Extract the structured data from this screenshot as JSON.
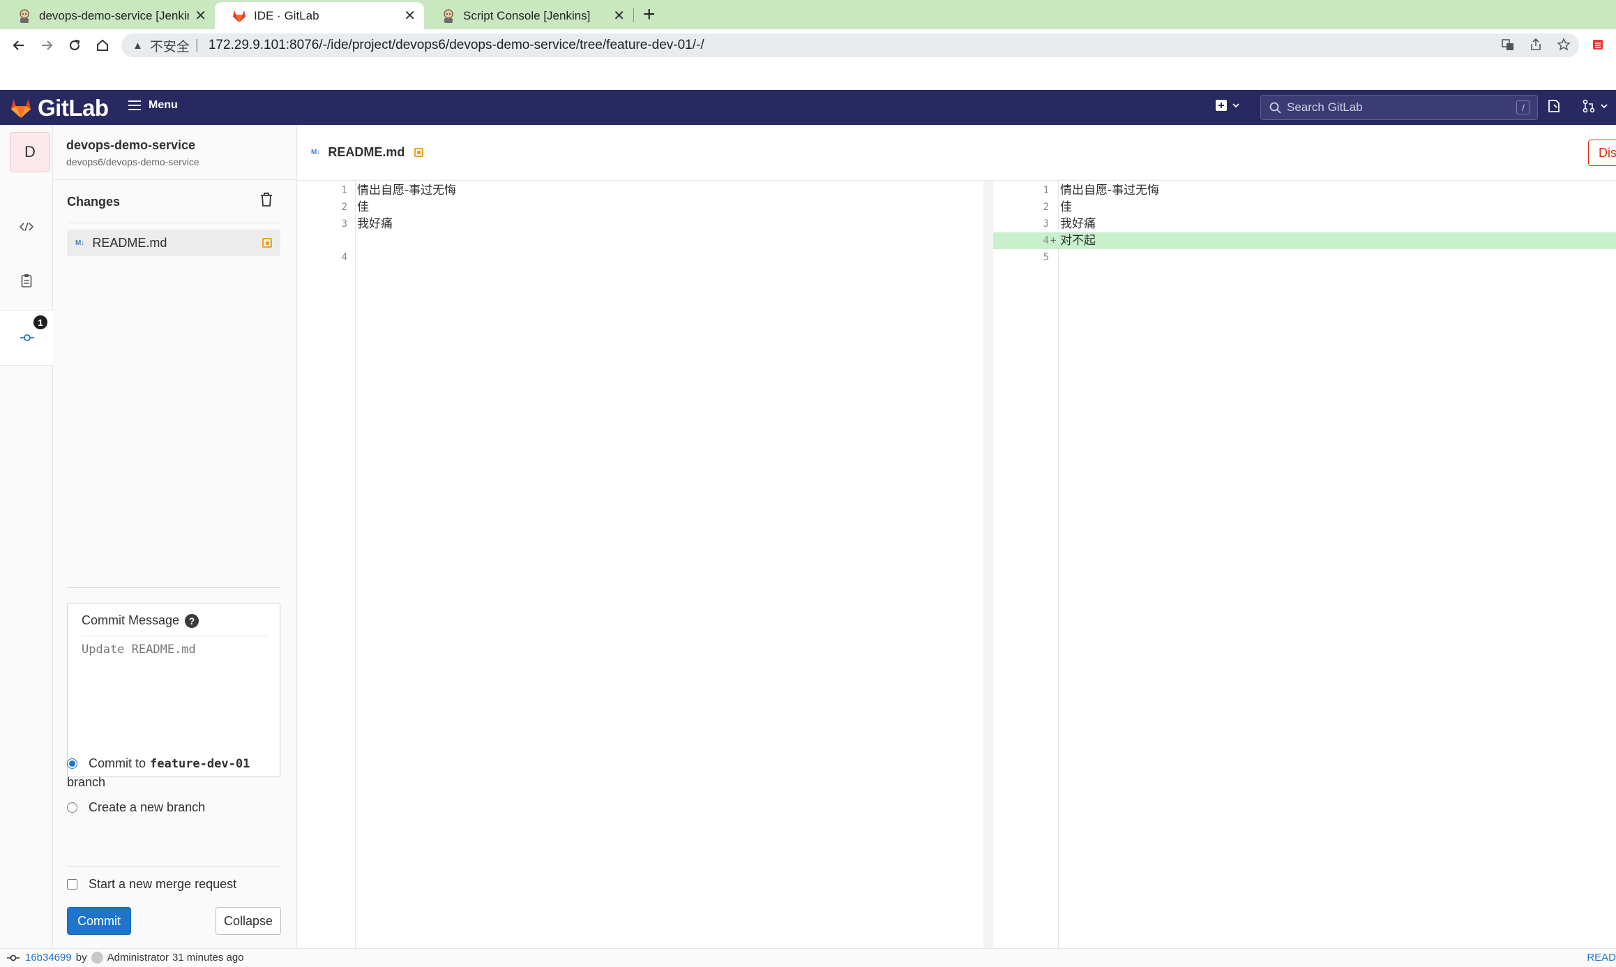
{
  "browser": {
    "tabs": [
      {
        "title": "devops-demo-service [Jenkins]",
        "favicon": "jenkins-icon",
        "active": false
      },
      {
        "title": "IDE · GitLab",
        "favicon": "gitlab-icon",
        "active": true
      },
      {
        "title": "Script Console [Jenkins]",
        "favicon": "jenkins-icon",
        "active": false
      }
    ],
    "new_tab_label": "+",
    "security_label": "不安全",
    "url": "172.29.9.101:8076/-/ide/project/devops6/devops-demo-service/tree/feature-dev-01/-/"
  },
  "gitlab": {
    "brand": "GitLab",
    "menu_label": "Menu",
    "search_placeholder": "Search GitLab",
    "search_shortcut": "/",
    "header_color": "#292961"
  },
  "ide": {
    "rail": {
      "avatar_letter": "D",
      "commit_badge": "1"
    },
    "project": {
      "name": "devops-demo-service",
      "path": "devops6/devops-demo-service"
    },
    "changes": {
      "title": "Changes",
      "files": [
        {
          "name": "README.md",
          "status": "modified"
        }
      ]
    },
    "commit": {
      "message_label": "Commit Message",
      "message_placeholder": "Update README.md",
      "option_existing_prefix": "Commit to",
      "branch": "feature-dev-01",
      "option_existing_suffix": "branch",
      "option_new": "Create a new branch",
      "merge_request": "Start a new merge request",
      "commit_button": "Commit",
      "collapse_button": "Collapse"
    },
    "editor": {
      "active_file": "README.md",
      "discard_label": "Discard",
      "left_lines": [
        {
          "n": "1",
          "text": "情出自愿-事过无悔"
        },
        {
          "n": "2",
          "text": "佳"
        },
        {
          "n": "3",
          "text": "我好痛"
        },
        {
          "n": "4",
          "text": ""
        }
      ],
      "right_lines": [
        {
          "n": "1",
          "text": "情出自愿-事过无悔",
          "added": false
        },
        {
          "n": "2",
          "text": "佳",
          "added": false
        },
        {
          "n": "3",
          "text": "我好痛",
          "added": false
        },
        {
          "n": "4",
          "text": "对不起",
          "added": true
        },
        {
          "n": "5",
          "text": "",
          "added": false
        }
      ]
    },
    "status": {
      "sha": "16b34699",
      "by": "by",
      "author": "Administrator",
      "time": "31 minutes ago",
      "right_label": "READ"
    }
  }
}
